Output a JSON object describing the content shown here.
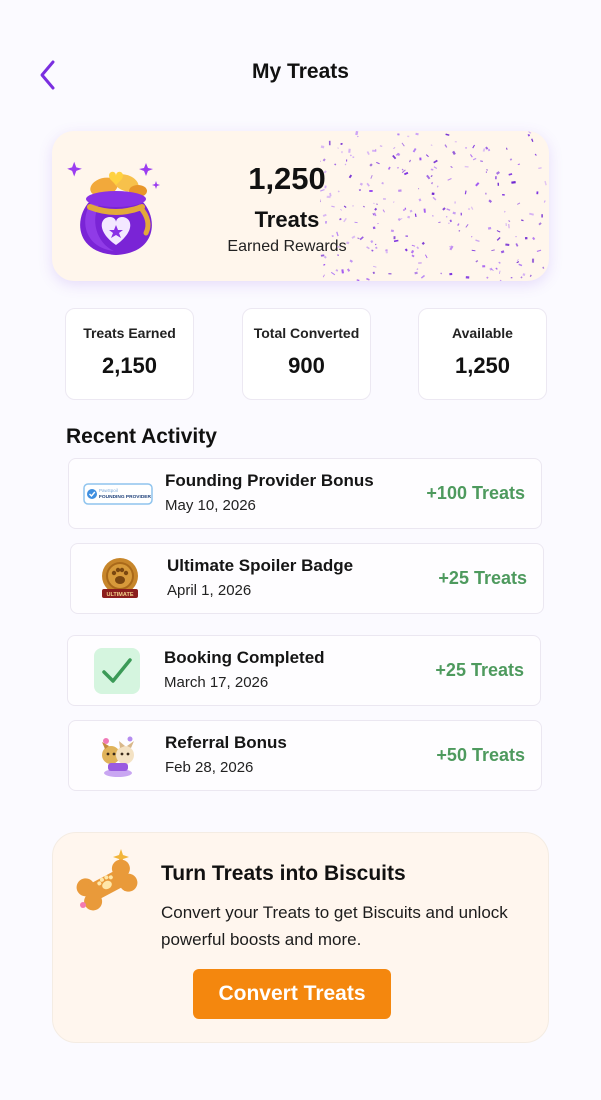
{
  "header": {
    "title": "My Treats"
  },
  "hero": {
    "amount": "1,250",
    "unit": "Treats",
    "subtitle": "Earned Rewards"
  },
  "stats": [
    {
      "label": "Treats Earned",
      "value": "2,150"
    },
    {
      "label": "Total Converted",
      "value": "900"
    },
    {
      "label": "Available",
      "value": "1,250"
    }
  ],
  "recent_activity": {
    "title": "Recent Activity",
    "items": [
      {
        "title": "Founding Provider Bonus",
        "date": "May 10, 2026",
        "points": "+100 Treats",
        "icon": "founding-provider-badge-icon",
        "badge_text": "FOUNDING PROVIDER"
      },
      {
        "title": "Ultimate Spoiler Badge",
        "date": "April 1, 2026",
        "points": "+25 Treats",
        "icon": "ultimate-spoiler-medal-icon",
        "badge_text": "ULTIMATE"
      },
      {
        "title": "Booking Completed",
        "date": "March 17, 2026",
        "points": "+25 Treats",
        "icon": "checkmark-icon"
      },
      {
        "title": "Referral Bonus",
        "date": "Feb 28, 2026",
        "points": "+50 Treats",
        "icon": "pets-illustration-icon"
      }
    ]
  },
  "convert": {
    "title": "Turn Treats into Biscuits",
    "description": "Convert your Treats to get Biscuits and unlock powerful boosts and more.",
    "button_label": "Convert Treats"
  },
  "colors": {
    "accent_purple": "#7a2ee0",
    "points_green": "#4e9a5e",
    "button_orange": "#f4870e",
    "hero_background": "#fff6ec"
  }
}
